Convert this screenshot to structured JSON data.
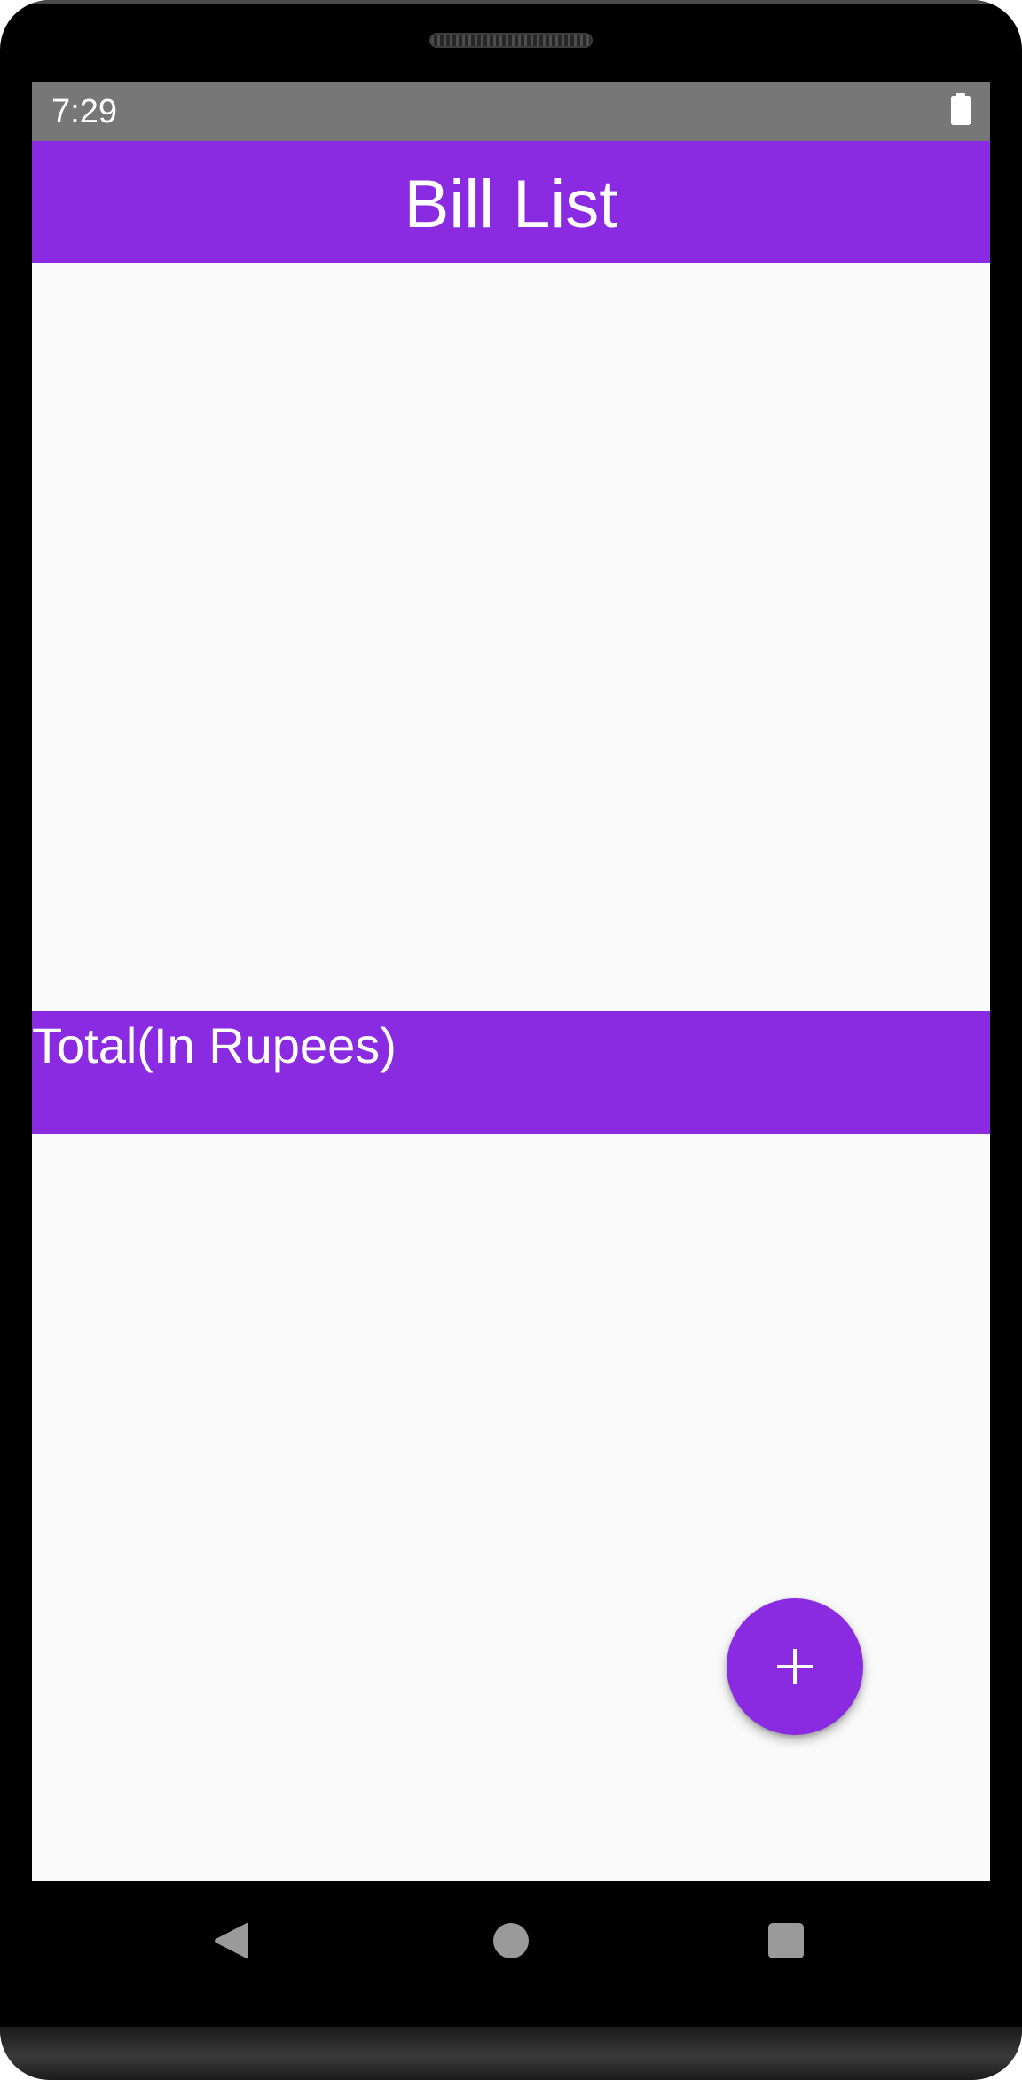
{
  "status_bar": {
    "time": "7:29",
    "battery_icon": "battery-full-icon"
  },
  "app_bar": {
    "title": "Bill List"
  },
  "bill_list": {
    "items": []
  },
  "total_bar": {
    "label": "Total(In Rupees)"
  },
  "fab": {
    "icon": "plus-icon"
  },
  "nav_bar": {
    "back_icon": "back-triangle-icon",
    "home_icon": "home-circle-icon",
    "recents_icon": "recents-square-icon"
  },
  "colors": {
    "accent": "#8a2be2",
    "status_bar": "#777777",
    "background": "#fafafa",
    "nav_icon": "#9a9a9a"
  }
}
